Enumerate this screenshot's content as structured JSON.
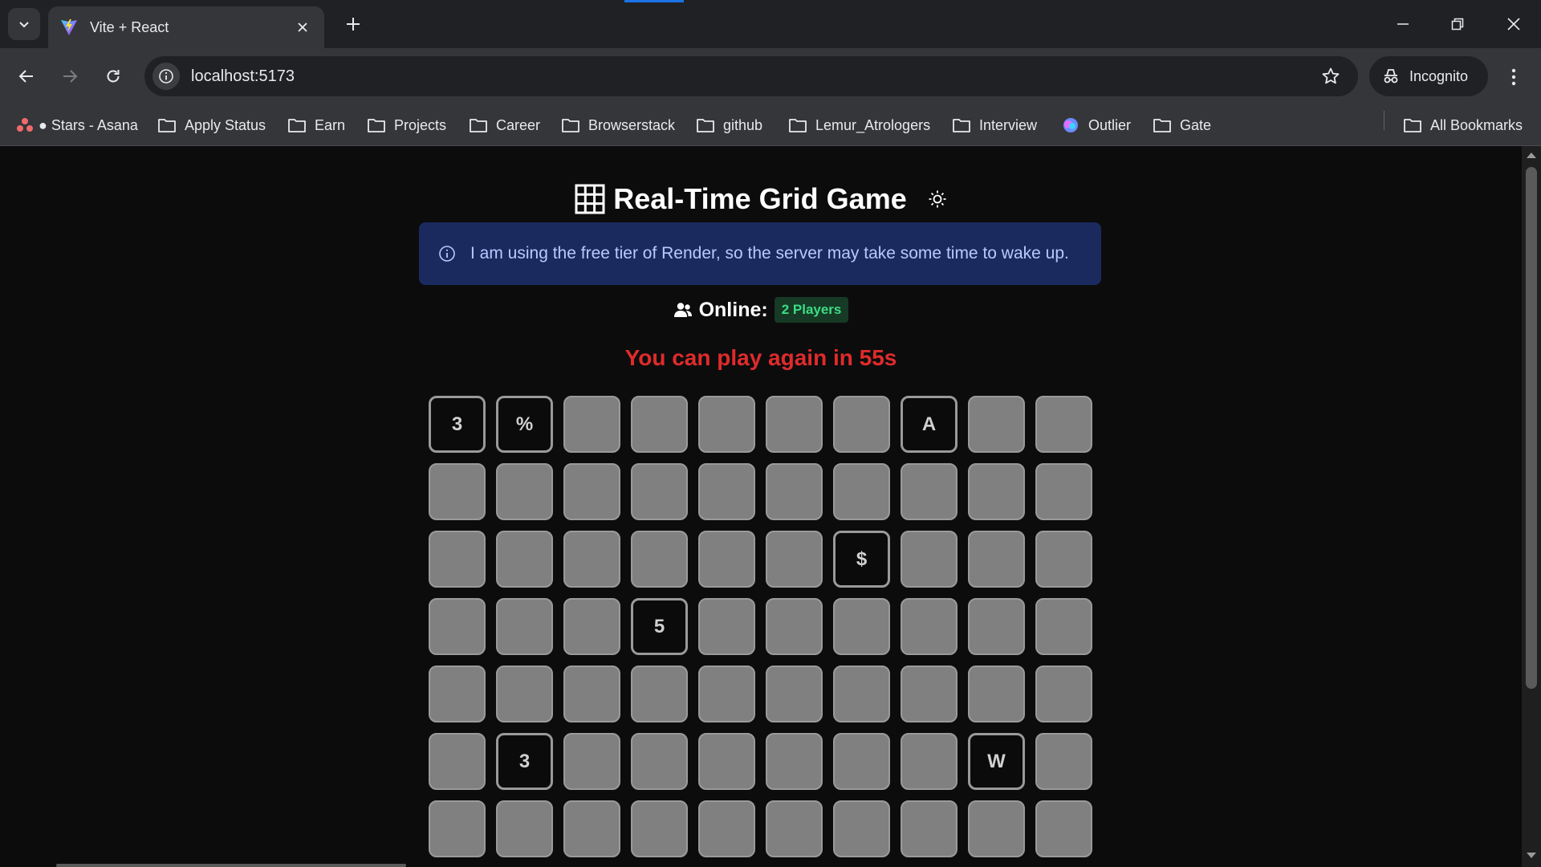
{
  "browser": {
    "tab_title": "Vite + React",
    "url": "localhost:5173",
    "profile_label": "Incognito",
    "bookmarks": [
      "● Stars - Asana",
      "Apply Status",
      "Earn",
      "Projects",
      "Career",
      "Browserstack",
      "github",
      "Lemur_Atrologers",
      "Interview",
      "Outlier",
      "Gate"
    ],
    "all_bookmarks_label": "All Bookmarks",
    "accent_color": "#1a73e8"
  },
  "page": {
    "title": "Real-Time Grid Game",
    "notice": "I am using the free tier of Render, so the server may take some time to wake up.",
    "online_label": "Online:",
    "online_count": "2 Players",
    "cooldown": "You can play again in 55s",
    "colors": {
      "notice_bg": "#1b2a5e",
      "notice_text": "#b7c9ff",
      "badge_bg": "#163a25",
      "badge_text": "#3ddc84",
      "cooldown": "#e02b2b",
      "empty_cell": "#808080",
      "filled_cell": "#0b0b0b"
    }
  },
  "grid": {
    "rows": [
      [
        "3",
        "%",
        "",
        "",
        "",
        "",
        "",
        "A",
        "",
        ""
      ],
      [
        "",
        "",
        "",
        "",
        "",
        "",
        "",
        "",
        "",
        ""
      ],
      [
        "",
        "",
        "",
        "",
        "",
        "",
        "$",
        "",
        "",
        ""
      ],
      [
        "",
        "",
        "",
        "5",
        "",
        "",
        "",
        "",
        "",
        ""
      ],
      [
        "",
        "",
        "",
        "",
        "",
        "",
        "",
        "",
        "",
        ""
      ],
      [
        "",
        "3",
        "",
        "",
        "",
        "",
        "",
        "",
        "W",
        ""
      ],
      [
        "",
        "",
        "",
        "",
        "",
        "",
        "",
        "",
        "",
        ""
      ]
    ]
  }
}
